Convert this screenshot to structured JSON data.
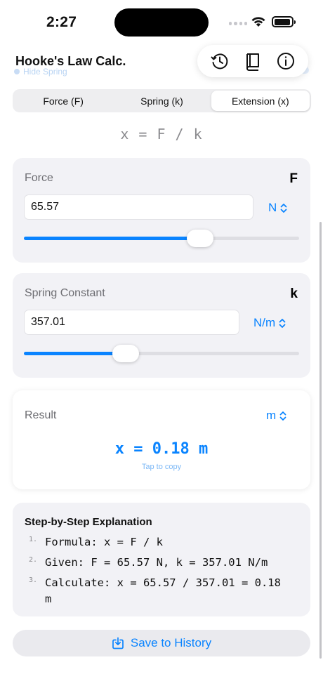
{
  "status": {
    "time": "2:27"
  },
  "nav": {
    "title": "Hooke's Law Calc.",
    "ghost_label": "Hide Spring",
    "actions": [
      "history-icon",
      "book-icon",
      "info-icon"
    ]
  },
  "tabs": [
    {
      "label": "Force (F)",
      "active": false
    },
    {
      "label": "Spring (k)",
      "active": false
    },
    {
      "label": "Extension (x)",
      "active": true
    }
  ],
  "formula": "x = F / k",
  "force": {
    "label": "Force",
    "symbol": "F",
    "value": "65.57",
    "unit": "N",
    "slider_fraction": 0.64
  },
  "spring": {
    "label": "Spring Constant",
    "symbol": "k",
    "value": "357.01",
    "unit": "N/m",
    "slider_fraction": 0.37
  },
  "result": {
    "label": "Result",
    "unit": "m",
    "value_text": "x = 0.18 m",
    "hint": "Tap to copy"
  },
  "steps": {
    "title": "Step-by-Step Explanation",
    "items": [
      {
        "num": "1.",
        "text": "Formula: x = F / k"
      },
      {
        "num": "2.",
        "text": "Given: F = 65.57 N, k = 357.01 N/m"
      },
      {
        "num": "3.",
        "text": "Calculate: x = 65.57 / 357.01 = 0.18 m"
      }
    ]
  },
  "save": {
    "label": "Save to History",
    "icon": "save-icon"
  },
  "colors": {
    "accent": "#0a84ff",
    "card": "#f2f2f6"
  }
}
